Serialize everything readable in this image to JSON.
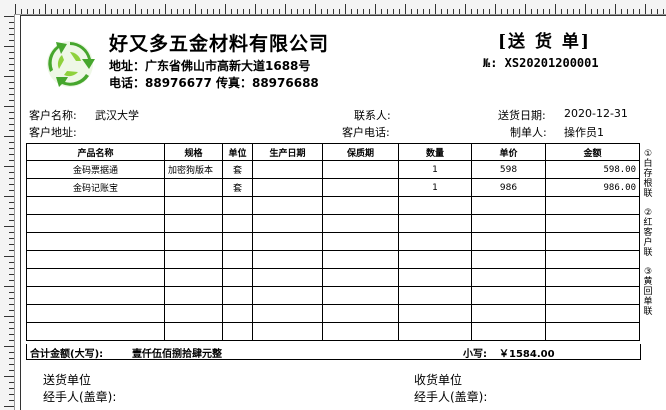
{
  "company": {
    "name": "好又多五金材料有限公司",
    "address": "地址：广东省佛山市高新大道1688号",
    "phone": "电话：88976677  传真：88976688"
  },
  "doc": {
    "title": "[送 货 单]",
    "number": "№: XS20201200001"
  },
  "header_fields": {
    "customer_name_label": "客户名称:",
    "customer_name": "武汉大学",
    "customer_addr_label": "客户地址:",
    "contact_label": "联系人:",
    "customer_phone_label": "客户电话:",
    "delivery_date_label": "送货日期:",
    "delivery_date": "2020-12-31",
    "maker_label": "制单人:",
    "maker": "操作员1"
  },
  "table": {
    "columns": [
      "产品名称",
      "规格",
      "单位",
      "生产日期",
      "保质期",
      "数量",
      "单价",
      "金额"
    ],
    "rows": [
      [
        "金码票据通",
        "加密狗版本",
        "套",
        "",
        "",
        "1",
        "598",
        "598.00"
      ],
      [
        "金码记账宝",
        "",
        "套",
        "",
        "",
        "1",
        "986",
        "986.00"
      ]
    ],
    "empty_rows": 8
  },
  "totals": {
    "upper_label": "合计金额(大写):",
    "upper_value": "壹仟伍佰捌拾肆元整",
    "lower_label": "小写:",
    "lower_value": "￥1584.00"
  },
  "side_labels": [
    "①白存根联",
    "②红客户联",
    "③黄回单联"
  ],
  "footer": {
    "sender_unit": "送货单位",
    "sender_handler": "经手人(盖章):",
    "receiver_unit": "收货单位",
    "receiver_handler": "经手人(盖章):"
  },
  "colors": {
    "logo_green": "#46a62d",
    "logo_light": "#8ed13c"
  }
}
